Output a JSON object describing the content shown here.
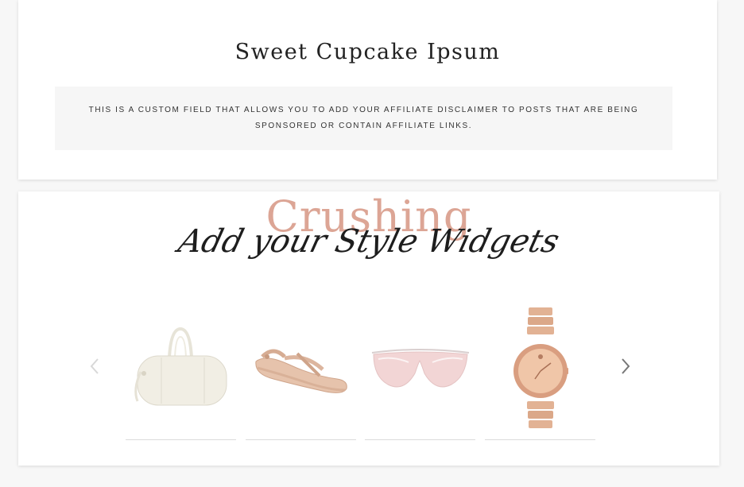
{
  "post": {
    "title": "Sweet Cupcake Ipsum",
    "disclaimer": "This is a custom field that allows you to add your affiliate disclaimer to posts that are being sponsored or contain affiliate links."
  },
  "widget": {
    "heading_background": "Crushing",
    "heading_script": "Add your Style Widgets",
    "accent_color": "#dca595",
    "carousel": {
      "prev_icon": "chevron-left-icon",
      "next_icon": "chevron-right-icon",
      "products": [
        {
          "name": "duffel-bag"
        },
        {
          "name": "sandal"
        },
        {
          "name": "sunglasses"
        },
        {
          "name": "watch"
        }
      ]
    }
  }
}
